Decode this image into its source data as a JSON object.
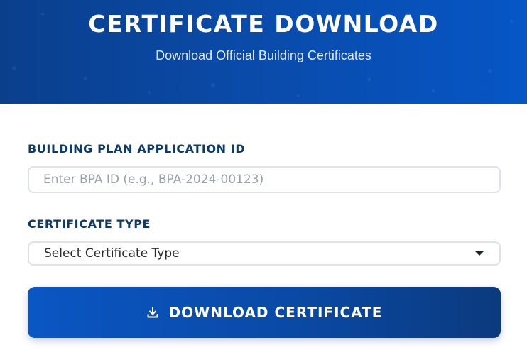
{
  "header": {
    "title": "CERTIFICATE DOWNLOAD",
    "subtitle": "Download Official Building Certificates"
  },
  "form": {
    "bpa_label": "BUILDING PLAN APPLICATION ID",
    "bpa_placeholder": "Enter BPA ID (e.g., BPA-2024-00123)",
    "bpa_value": "",
    "type_label": "CERTIFICATE TYPE",
    "type_selected": "Select Certificate Type",
    "download_label": "DOWNLOAD CERTIFICATE"
  },
  "icons": {
    "download": "download-icon",
    "dropdown": "chevron-down-icon"
  },
  "colors": {
    "header_blue": "#0a4aa8",
    "label_navy": "#0d3a66",
    "button_blue": "#0a56c4"
  }
}
